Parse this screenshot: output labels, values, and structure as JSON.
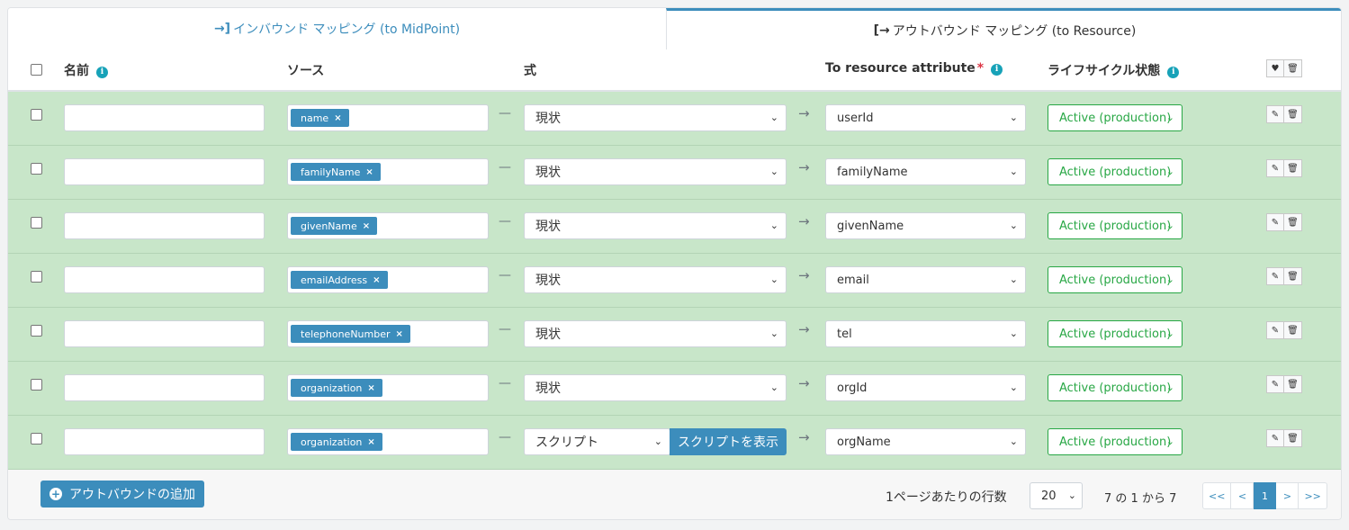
{
  "tabs": {
    "inbound": "インバウンド マッピング (to MidPoint)",
    "outbound": "アウトバウンド マッピング (to Resource)"
  },
  "headers": {
    "name": "名前",
    "source": "ソース",
    "expression": "式",
    "target": "To resource attribute",
    "required_mark": "*",
    "lifecycle": "ライフサイクル状態",
    "info_glyph": "i"
  },
  "rows": [
    {
      "name": "",
      "source": "name",
      "expression": "現状",
      "target": "userId",
      "lifecycle": "Active (production)"
    },
    {
      "name": "",
      "source": "familyName",
      "expression": "現状",
      "target": "familyName",
      "lifecycle": "Active (production)"
    },
    {
      "name": "",
      "source": "givenName",
      "expression": "現状",
      "target": "givenName",
      "lifecycle": "Active (production)"
    },
    {
      "name": "",
      "source": "emailAddress",
      "expression": "現状",
      "target": "email",
      "lifecycle": "Active (production)"
    },
    {
      "name": "",
      "source": "telephoneNumber",
      "expression": "現状",
      "target": "tel",
      "lifecycle": "Active (production)"
    },
    {
      "name": "",
      "source": "organization",
      "expression": "現状",
      "target": "orgId",
      "lifecycle": "Active (production)"
    },
    {
      "name": "",
      "source": "organization",
      "expression": "スクリプト",
      "script_button": "スクリプトを表示",
      "target": "orgName",
      "lifecycle": "Active (production)"
    }
  ],
  "footer": {
    "add_button": "アウトバウンドの追加",
    "per_page_label": "1ページあたりの行数",
    "per_page_value": "20",
    "count_text": "7 の 1 から 7",
    "pager": [
      "<<",
      "<",
      "1",
      ">",
      ">>"
    ],
    "current_page": "1"
  },
  "icons": {
    "tab_inbound": "sign-in-icon",
    "tab_outbound": "sign-out-icon",
    "header_actions": [
      "heart-pulse-icon",
      "trash-icon"
    ],
    "row_actions": [
      "edit-icon",
      "trash-icon"
    ],
    "add": "plus-circle-icon"
  },
  "colors": {
    "accent": "#3c8dbc",
    "row_background": "#c8e6c9",
    "lifecycle_green": "#28a745",
    "info": "#17a2b8",
    "required": "#dc3545"
  }
}
